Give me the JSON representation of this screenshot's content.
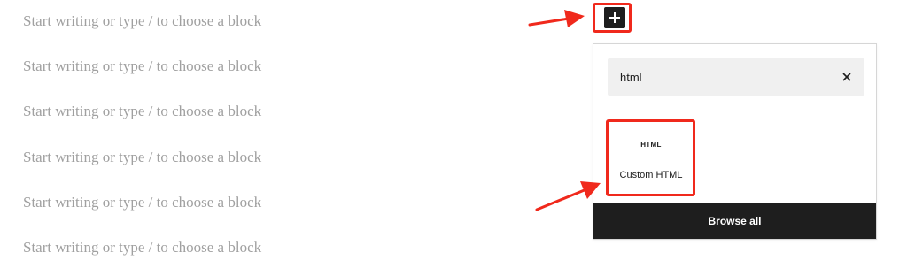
{
  "editor": {
    "placeholder_lines": [
      "Start writing or type / to choose a block",
      "Start writing or type / to choose a block",
      "Start writing or type / to choose a block",
      "Start writing or type / to choose a block",
      "Start writing or type / to choose a block",
      "Start writing or type / to choose a block"
    ]
  },
  "inserter": {
    "button_icon": "plus-icon"
  },
  "popover": {
    "search_value": "html",
    "clear_icon": "close-icon",
    "results": [
      {
        "icon_text": "HTML",
        "label": "Custom HTML"
      }
    ],
    "browse_all_label": "Browse all"
  },
  "annotations": {
    "highlight_color": "#f0291c",
    "arrow_color": "#f0291c"
  }
}
